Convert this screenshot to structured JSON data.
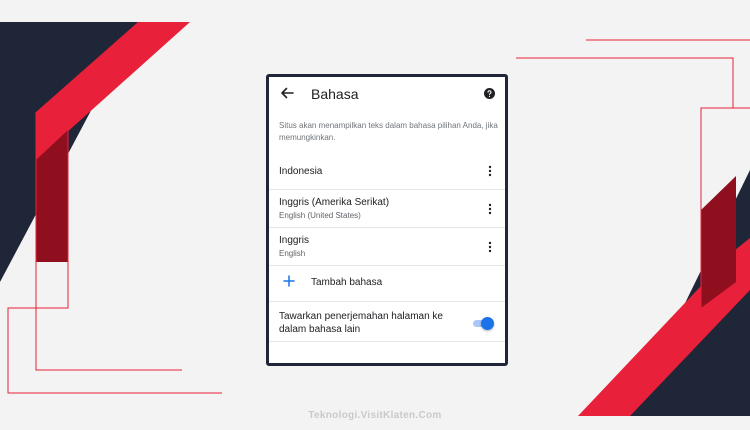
{
  "colors": {
    "navy": "#1f2638",
    "red": "#e8203a",
    "dark_red": "#8f0f1f",
    "accent_blue": "#1a73e8"
  },
  "appbar": {
    "back_icon": "arrow-left-icon",
    "title": "Bahasa",
    "help_icon": "help-circle-icon"
  },
  "description": "Situs akan menampilkan teks dalam bahasa pilihan Anda, jika memungkinkan.",
  "languages": [
    {
      "label": "Indonesia",
      "sublabel": ""
    },
    {
      "label": "Inggris (Amerika Serikat)",
      "sublabel": "English (United States)"
    },
    {
      "label": "Inggris",
      "sublabel": "English"
    }
  ],
  "add_language": {
    "icon": "plus-icon",
    "label": "Tambah bahasa"
  },
  "translate_offer": {
    "label": "Tawarkan penerjemahan halaman ke dalam bahasa lain",
    "enabled": true
  },
  "watermark": "Teknologi.VisitKlaten.Com"
}
